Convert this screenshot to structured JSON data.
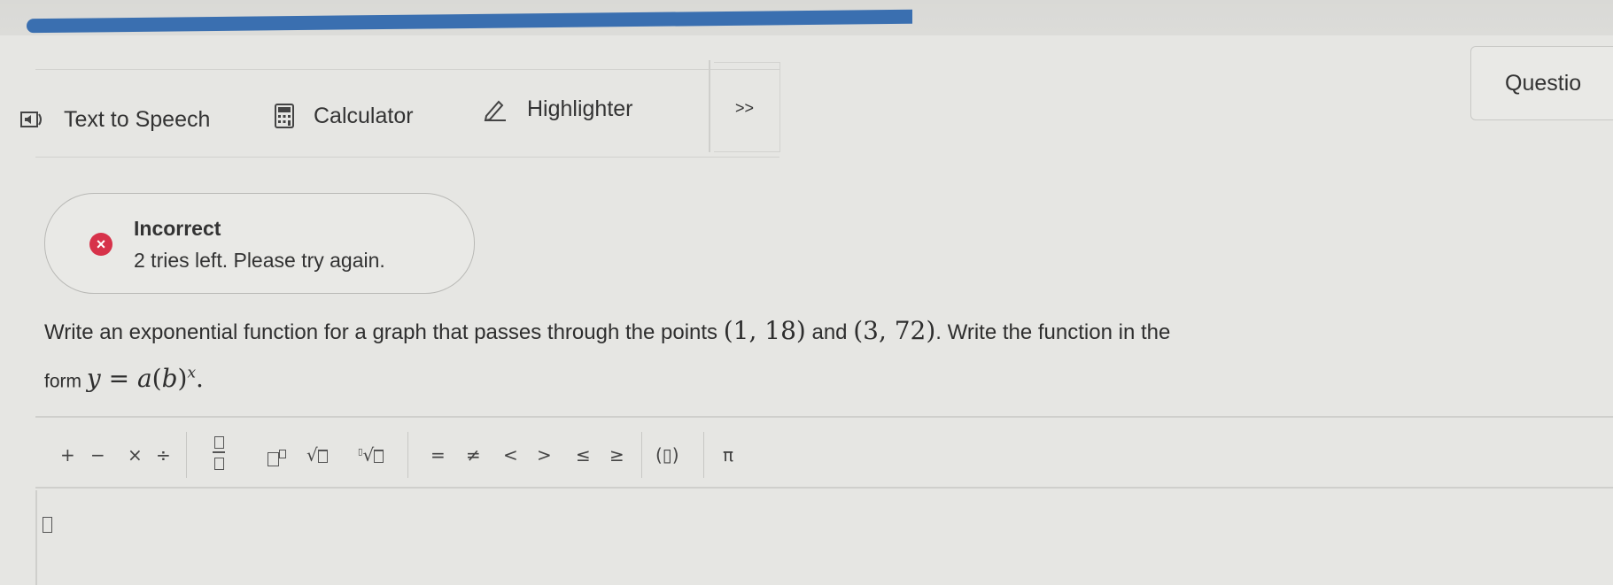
{
  "toolbar": {
    "text_to_speech": "Text to Speech",
    "calculator": "Calculator",
    "highlighter": "Highlighter",
    "more": ">>",
    "question": "Questio"
  },
  "feedback": {
    "title": "Incorrect",
    "message": "2 tries left. Please try again."
  },
  "prompt": {
    "part1": "Write an exponential function for a graph that passes through the points",
    "point1": "(1, 18)",
    "and": "and",
    "point2": "(3, 72)",
    "part2": ". Write the function in the",
    "form_label": "form"
  },
  "palette": {
    "plus": "+",
    "minus": "−",
    "times": "×",
    "divide": "÷",
    "equals": "=",
    "not_equal": "≠",
    "less": "<",
    "greater": ">",
    "leq": "≤",
    "geq": "≥",
    "parens": "(▯)",
    "pi": "π"
  },
  "colors": {
    "accent_blue": "#3a6fb0",
    "error_red": "#d7324a",
    "background": "#e6e6e3"
  }
}
